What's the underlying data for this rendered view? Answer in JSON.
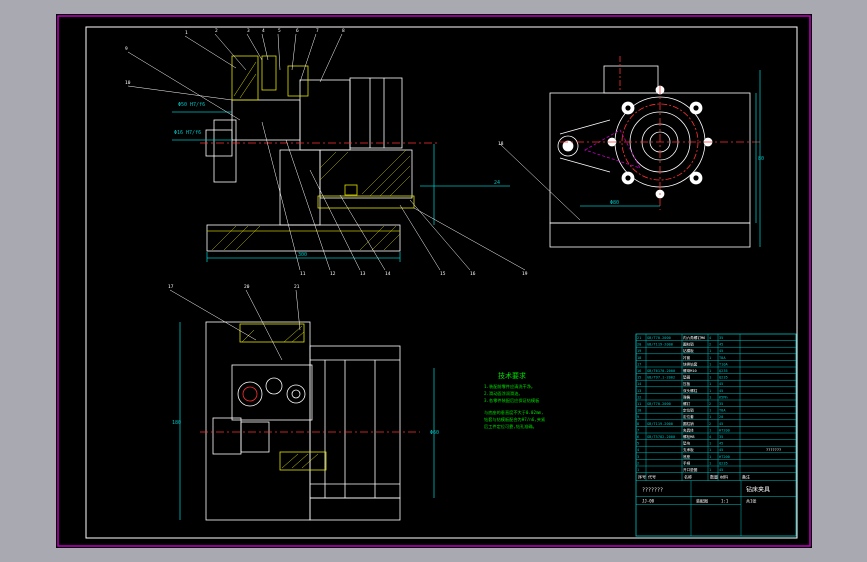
{
  "colors": {
    "background": "#a9a9b1",
    "sheet": "#000000",
    "frame": "#c000c0",
    "line": "#ffffff",
    "dim": "#00c0c0",
    "part": "#e0e000",
    "section": "#c0c000",
    "center": "#ff3030",
    "note": "#00e000",
    "table": "#00c0c0"
  },
  "top_view": {
    "label_d": "Φ50 H7/f6",
    "label_e": "Φ16 H7/f6",
    "dim_width": "300",
    "dim_small": "24",
    "callouts": [
      "1",
      "2",
      "3",
      "4",
      "5",
      "6",
      "7",
      "8",
      "9",
      "10",
      "11",
      "12",
      "13",
      "14",
      "15",
      "16"
    ]
  },
  "side_view": {
    "dim_width": "Φ80",
    "dim_height": "80",
    "callouts": [
      "18",
      "19"
    ]
  },
  "front_view": {
    "dim_height": "180",
    "dim_right": "Φ60",
    "callouts": [
      "17",
      "20",
      "21"
    ]
  },
  "notes": {
    "title": "技术要求",
    "lines": [
      "1.装配前零件应清洗干净。",
      "2.滑动面涂润滑油。",
      "3.各零件装配后应保证钻模板",
      "与底座的垂直度不大于0.02mm,",
      "钻套与钻模板配合为H7/n6,夹紧",
      "后工件定位可靠,钻孔准确。"
    ]
  },
  "bom": {
    "rows": [
      [
        "21",
        "GB/T70-2000",
        "内六角螺钉M6",
        "4",
        "35"
      ],
      [
        "20",
        "GB/T119-2000",
        "圆柱销",
        "2",
        "45"
      ],
      [
        "19",
        "",
        "钻模板",
        "1",
        "45"
      ],
      [
        "18",
        "",
        "衬套",
        "1",
        "T8A"
      ],
      [
        "17",
        "",
        "快换钻套",
        "1",
        "T10A"
      ],
      [
        "16",
        "GB/T6170-2000",
        "螺母M10",
        "1",
        "Q235"
      ],
      [
        "15",
        "GB/T97.1-2002",
        "垫圈",
        "1",
        "Q235"
      ],
      [
        "14",
        "",
        "压板",
        "1",
        "45"
      ],
      [
        "13",
        "",
        "双头螺柱",
        "1",
        "45"
      ],
      [
        "12",
        "",
        "弹簧",
        "1",
        "65Mn"
      ],
      [
        "11",
        "GB/T70-2000",
        "螺钉",
        "2",
        "35"
      ],
      [
        "10",
        "",
        "定位销",
        "1",
        "T8A"
      ],
      [
        "9",
        "",
        "定位套",
        "1",
        "20"
      ],
      [
        "8",
        "GB/T119-2000",
        "圆柱销",
        "2",
        "45"
      ],
      [
        "7",
        "",
        "夹具体",
        "1",
        "HT200"
      ],
      [
        "6",
        "GB/T5782-2000",
        "螺栓M8",
        "4",
        "35"
      ],
      [
        "5",
        "",
        "垫块",
        "1",
        "45"
      ],
      [
        "4",
        "",
        "支承板",
        "1",
        "45"
      ],
      [
        "3",
        "",
        "底座",
        "1",
        "HT200"
      ],
      [
        "2",
        "",
        "手柄",
        "1",
        "Q235"
      ],
      [
        "1",
        "",
        "开口垫圈",
        "1",
        "45"
      ]
    ],
    "header": [
      "序号",
      "代号",
      "名称",
      "数量",
      "材料",
      "备注"
    ],
    "title_text": "钻床夹具",
    "subtitle": "???????",
    "drawing_no": "装配图",
    "scale": "1:1",
    "sheet": "共1张",
    "dwg_id": "JJ-00"
  }
}
